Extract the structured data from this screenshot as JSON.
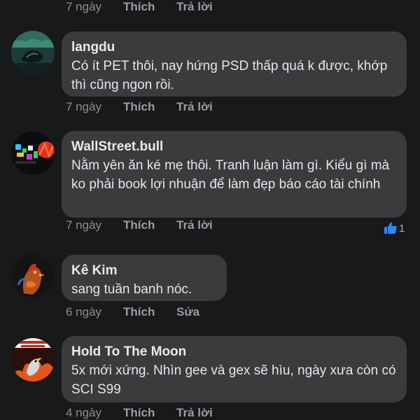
{
  "top_actions": {
    "time": "7 ngày",
    "like": "Thích",
    "reply": "Trả lời"
  },
  "comments": [
    {
      "author": "langdu",
      "text": "Có ít PET thôi, nay hứng PSD thấp quá k được, khớp thì cũng ngon rồi.",
      "time": "7 ngày",
      "like": "Thích",
      "action": "Trả lời"
    },
    {
      "author": "WallStreet.bull",
      "text": "Nằm yên ăn ké mẹ thôi. Tranh luận làm gì. Kiểu gì mà ko phải book lợi nhuận để làm đẹp báo cáo tài chính",
      "time": "7 ngày",
      "like": "Thích",
      "action": "Trả lời",
      "reaction_count": "1"
    },
    {
      "author": "Kê Kim",
      "text": "sang tuần banh nóc.",
      "time": "6 ngày",
      "like": "Thích",
      "action": "Sửa"
    },
    {
      "author": "Hold To The Moon",
      "text": "5x mới xứng. Nhìn gee và gex sẽ hìu, ngày xưa còn có SCI S99",
      "time": "4 ngày",
      "like": "Thích",
      "action": "Trả lời"
    }
  ],
  "colors": {
    "background": "#18191a",
    "bubble": "#3a3b3c",
    "like_reaction": "#2d88ff"
  }
}
